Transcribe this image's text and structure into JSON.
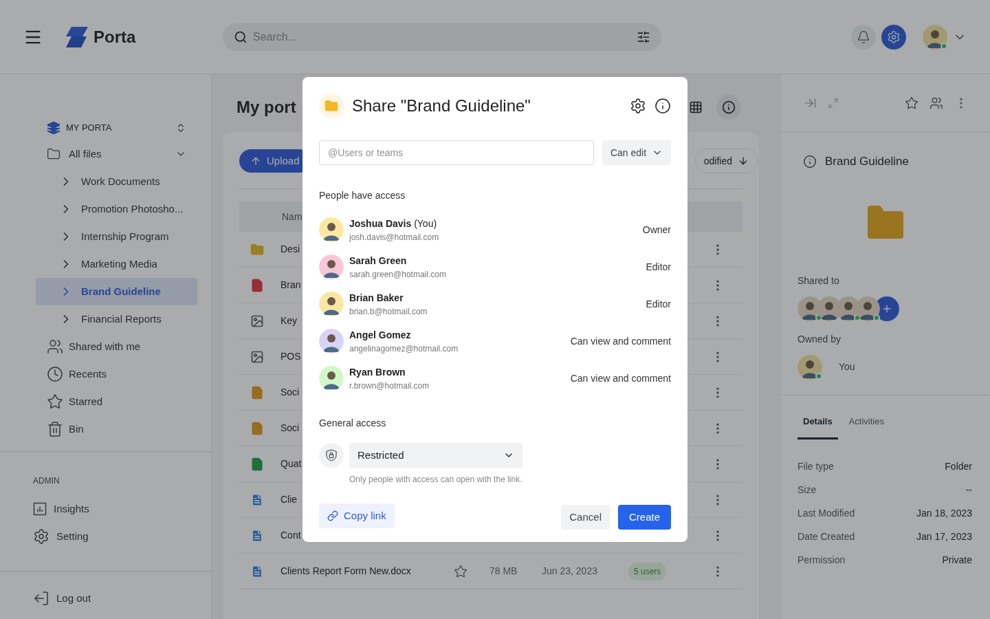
{
  "header": {
    "logo": "Porta",
    "search_placeholder": "Search...",
    "user_online": true
  },
  "sidebar": {
    "workspace": "MY PORTA",
    "all_files": {
      "label": "All files",
      "expanded": true,
      "children": [
        {
          "label": "Work Documents",
          "selected": false
        },
        {
          "label": "Promotion Photosho...",
          "selected": false
        },
        {
          "label": "Internship Program",
          "selected": false
        },
        {
          "label": "Marketing Media",
          "selected": false
        },
        {
          "label": "Brand Guideline",
          "selected": true
        },
        {
          "label": "Financial Reports",
          "selected": false
        }
      ]
    },
    "nav": [
      {
        "label": "Shared with me",
        "kind": "shared"
      },
      {
        "label": "Recents",
        "kind": "recents"
      },
      {
        "label": "Starred",
        "kind": "starred"
      },
      {
        "label": "Bin",
        "kind": "bin"
      }
    ],
    "admin_heading": "ADMIN",
    "admin": [
      {
        "label": "Insights",
        "kind": "insights"
      },
      {
        "label": "Setting",
        "kind": "settings"
      }
    ],
    "logout": "Log out"
  },
  "main": {
    "title": "My port",
    "upload": "Upload",
    "sort": "odified",
    "column_name": "Nam",
    "rows": [
      {
        "name": "Desi",
        "kind": "folder"
      },
      {
        "name": "Bran",
        "kind": "pdf"
      },
      {
        "name": "Key",
        "kind": "image"
      },
      {
        "name": "POS",
        "kind": "image"
      },
      {
        "name": "Soci",
        "kind": "ai"
      },
      {
        "name": "Soci",
        "kind": "ai"
      },
      {
        "name": "Quat",
        "kind": "xlsx"
      },
      {
        "name": "Clie",
        "kind": "doc"
      },
      {
        "name": "Cont",
        "kind": "doc"
      },
      {
        "name": "Clients Report Form New.docx",
        "kind": "doc",
        "starred": false,
        "size": "78 MB",
        "date": "Jun 23, 2023",
        "shared": "5 users"
      }
    ]
  },
  "details_panel": {
    "title": "Brand Guideline",
    "shared_to": "Shared to",
    "shared_avatars": [
      {
        "online": true
      },
      {
        "online": false
      },
      {
        "online": true
      },
      {
        "online": true
      }
    ],
    "owned_by": "Owned by",
    "owner": "You",
    "owner_online": true,
    "tabs": [
      {
        "label": "Details",
        "selected": true
      },
      {
        "label": "Activities",
        "selected": false
      }
    ],
    "details": [
      {
        "label": "File type",
        "value": "Folder"
      },
      {
        "label": "Size",
        "value": "--"
      },
      {
        "label": "Last Modified",
        "value": "Jan 18, 2023"
      },
      {
        "label": "Date Created",
        "value": "Jan 17, 2023"
      },
      {
        "label": "Permission",
        "value": "Private"
      }
    ]
  },
  "share_dialog": {
    "title": "Share \"Brand Guideline\"",
    "invite_placeholder": "@Users or teams",
    "invite_role": "Can edit",
    "people_heading": "People have access",
    "people": [
      {
        "name": "**Joshua Davis** (You)",
        "email": "josh.davis@hotmail.com",
        "role": "Owner",
        "color": "#fbe7a1"
      },
      {
        "name": "**Sarah Green**",
        "email": "sarah.green@hotmail.com",
        "role": "Editor",
        "color": "#f9c6d8"
      },
      {
        "name": "**Brian Baker**",
        "email": "brian.b@hotmail.com",
        "role": "Editor",
        "color": "#fbe7a1"
      },
      {
        "name": "**Angel Gomez**",
        "email": "angelinagomez@hotmail.com",
        "role": "Can view and comment",
        "color": "#d9d3f7"
      },
      {
        "name": "**Ryan Brown**",
        "email": "r.brown@hotmail.com",
        "role": "Can view and comment",
        "color": "#d3f7c9"
      }
    ],
    "general_heading": "General access",
    "access": "Restricted",
    "access_note": "Only people with access can open with the link.",
    "copy_link": "Copy link",
    "cancel": "Cancel",
    "create": "Create"
  }
}
